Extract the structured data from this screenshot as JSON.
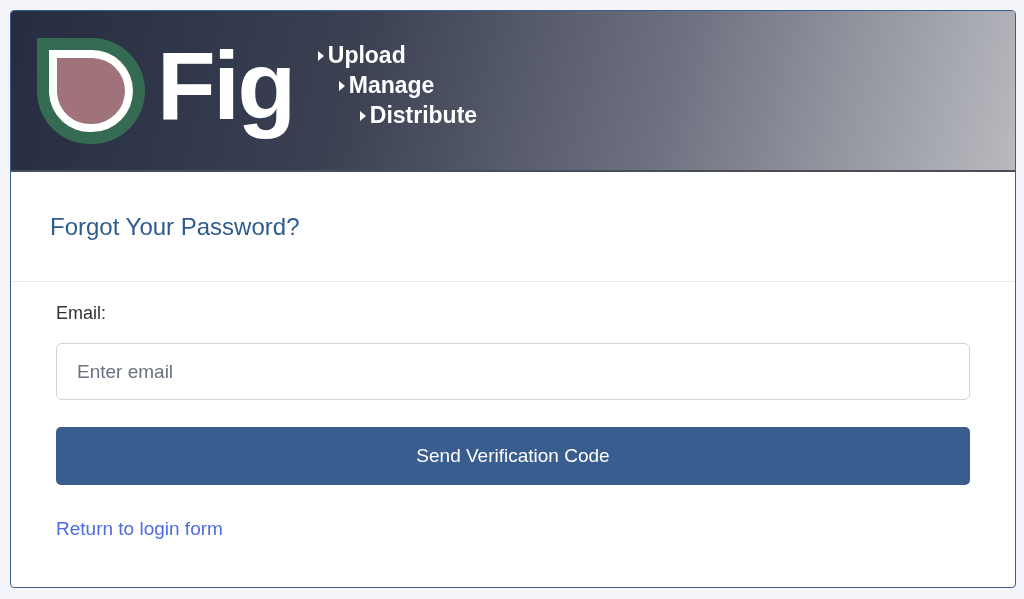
{
  "header": {
    "logo_text": "Fig",
    "tagline": [
      "Upload",
      "Manage",
      "Distribute"
    ]
  },
  "title": "Forgot Your Password?",
  "email_field": {
    "label": "Email:",
    "placeholder": "Enter email"
  },
  "submit_button": "Send Verification Code",
  "return_link": "Return to login form"
}
